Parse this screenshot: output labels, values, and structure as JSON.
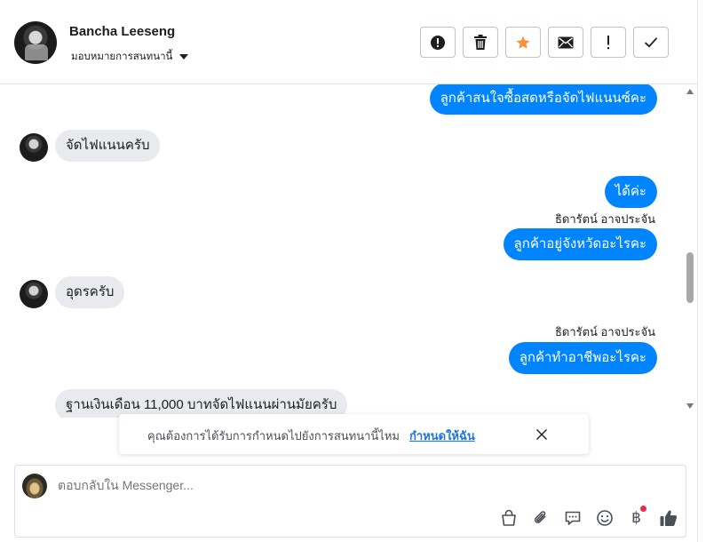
{
  "header": {
    "contact_name": "Bancha Leeseng",
    "assign_label": "มอบหมายการสนทนานี้",
    "actions": [
      {
        "name": "spam-button",
        "icon": "exclamation-circle-icon"
      },
      {
        "name": "delete-button",
        "icon": "trash-icon"
      },
      {
        "name": "star-button",
        "icon": "star-icon",
        "color": "#f7923b"
      },
      {
        "name": "mark-unread-button",
        "icon": "envelope-icon"
      },
      {
        "name": "follow-up-button",
        "icon": "exclamation-icon"
      },
      {
        "name": "done-button",
        "icon": "checkmark-icon"
      }
    ]
  },
  "messages": [
    {
      "type": "out",
      "text": "ลูกค้าสนใจซื้อสดหรือจัดไฟแนนซ์คะ"
    },
    {
      "type": "in",
      "text": "จัดไฟแนนครับ"
    },
    {
      "type": "out",
      "text": "ได้ค่ะ"
    },
    {
      "type": "sender",
      "text": "ธิดารัตน์ อาจประจัน"
    },
    {
      "type": "out",
      "text": "ลูกค้าอยู่จังหวัดอะไรคะ"
    },
    {
      "type": "in",
      "text": "อุดรครับ"
    },
    {
      "type": "sender",
      "text": "ธิดารัตน์ อาจประจัน"
    },
    {
      "type": "out",
      "text": "ลูกค้าทำอาชีพอะไรคะ"
    },
    {
      "type": "in",
      "text": "ฐานเงินเดือน 11,000 บาทจัดไฟแนนผ่านมัยครับ"
    }
  ],
  "notice": {
    "text": "คุณต้องการได้รับการกำหนดไปยังการสนทนานี้ไหม",
    "link": "กำหนดให้ฉัน"
  },
  "composer": {
    "placeholder": "ตอบกลับใน Messenger...",
    "tools": [
      "shopping-bag-icon",
      "paperclip-icon",
      "saved-reply-icon",
      "emoji-icon",
      "baht-payment-icon",
      "thumbs-up-icon"
    ],
    "baht_symbol": "฿"
  },
  "colors": {
    "outgoing_bubble": "#0084ff",
    "incoming_bubble": "#e9eaed",
    "link": "#1b74e4",
    "notification_dot": "#f02849"
  }
}
